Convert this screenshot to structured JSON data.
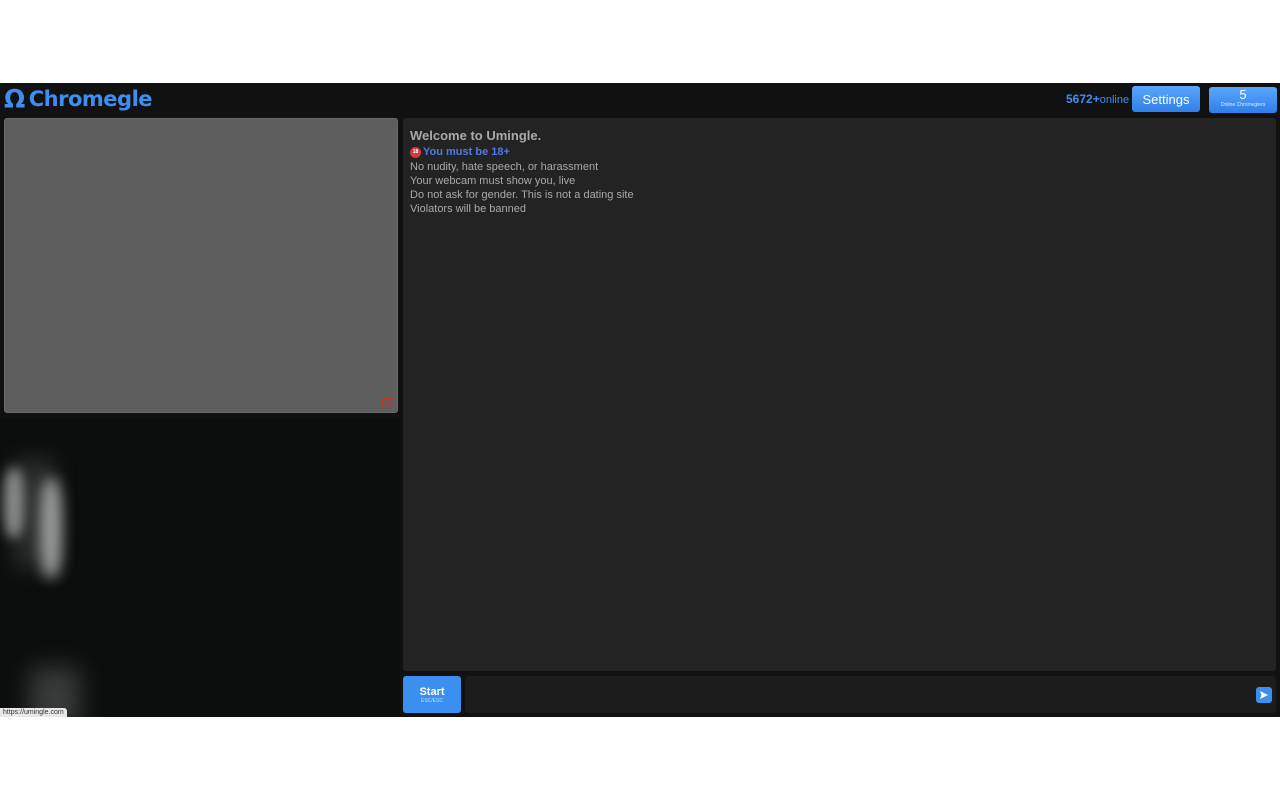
{
  "header": {
    "logo_symbol": "Ω",
    "logo_text": "Chromegle",
    "online_count": "5672+",
    "online_word": "online",
    "settings_label": "Settings",
    "online_chromeglers_count": "5",
    "online_chromeglers_label": "Online Chromeglers"
  },
  "chat": {
    "welcome": "Welcome to Umingle.",
    "age_rule": "You must be 18+",
    "age_icon_text": "18",
    "rules": [
      "No nudity, hate speech, or harassment",
      "Your webcam must show you, live",
      "Do not ask for gender. This is not a dating site",
      "Violators will be banned"
    ]
  },
  "controls": {
    "start_label": "Start",
    "start_sub": "ESC/ESC",
    "message_placeholder": ""
  },
  "status_bar": {
    "url": "https://umingle.com"
  },
  "colors": {
    "accent": "#3d8ef0",
    "panel": "#232323",
    "background": "#111111"
  },
  "icons": {
    "report": "flag-icon",
    "send": "send-arrow-icon",
    "age": "no-under-18-icon"
  }
}
